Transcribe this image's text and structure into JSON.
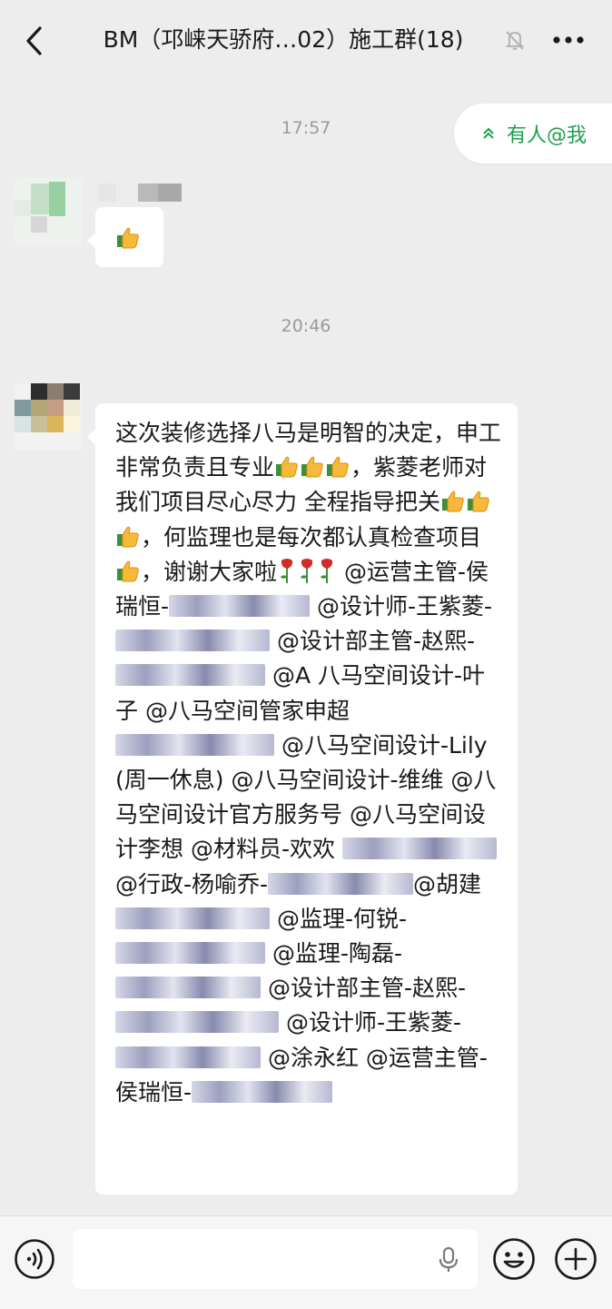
{
  "header": {
    "title": "BM（邛崃天骄府…02）施工群(18)"
  },
  "mention_pill": {
    "label": "有人@我"
  },
  "timestamps": [
    "17:57",
    "20:46"
  ],
  "messages": [
    {
      "sender_redacted": true,
      "content": "thumbs-up emoji"
    },
    {
      "sender_redacted": true,
      "segments": [
        "这次装修选择八马是明智的决定，申工非常负责且专业",
        "，紫菱老师对我们项目尽心尽力 全程指导把关",
        "，何监理也是每次都认真检查项目",
        "，谢谢大家啦",
        "@运营主管-侯瑞恒-",
        "@设计师-王紫菱-",
        "@设计部主管-赵熙-",
        "@A 八马空间设计-叶子 @八马空间管家申超",
        "@八马空间设计-Lily (周一休息) @八马空间设计-维维 @八马空间设计官方服务号 @八马空间设计李想 @材料员-欢欢",
        "@行政-杨喻乔-",
        "@胡建",
        "@监理-何锐-",
        "@监理-陶磊-",
        "@设计部主管-赵熙-",
        "@设计师-王紫菱-",
        "@涂永红 @运营主管-侯瑞恒-"
      ]
    }
  ],
  "icons": {
    "back": "chevron-left-icon",
    "mute": "bell-off-icon",
    "more": "ellipsis-icon",
    "mention_chevron": "double-chevron-up-icon",
    "voice": "voice-mode-icon",
    "mic": "microphone-icon",
    "emoji": "emoji-icon",
    "plus": "plus-icon",
    "thumb": "thumbs-up-emoji",
    "rose": "rose-emoji"
  },
  "colors": {
    "background": "#ededed",
    "bubble": "#ffffff",
    "accent_green": "#1f9e4e",
    "timestamp": "#9a9a9a"
  }
}
